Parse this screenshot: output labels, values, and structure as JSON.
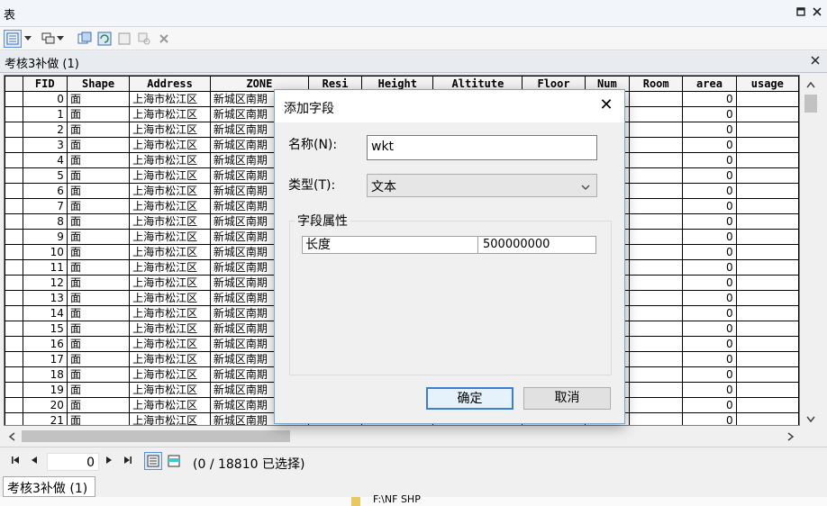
{
  "window": {
    "title": "表"
  },
  "table_tab": {
    "title": "考核3补做 (1)"
  },
  "columns": [
    "FID",
    "Shape",
    "Address",
    "ZONE",
    "Resi",
    "Height",
    "Altitute",
    "Floor",
    "Num",
    "Room",
    "area",
    "usage"
  ],
  "rows": [
    {
      "fid": "0",
      "shape": "面",
      "address": "上海市松江区",
      "zone": "新城区南期",
      "area": "0"
    },
    {
      "fid": "1",
      "shape": "面",
      "address": "上海市松江区",
      "zone": "新城区南期",
      "area": "0"
    },
    {
      "fid": "2",
      "shape": "面",
      "address": "上海市松江区",
      "zone": "新城区南期",
      "area": "0"
    },
    {
      "fid": "3",
      "shape": "面",
      "address": "上海市松江区",
      "zone": "新城区南期",
      "area": "0"
    },
    {
      "fid": "4",
      "shape": "面",
      "address": "上海市松江区",
      "zone": "新城区南期",
      "area": "0"
    },
    {
      "fid": "5",
      "shape": "面",
      "address": "上海市松江区",
      "zone": "新城区南期",
      "area": "0"
    },
    {
      "fid": "6",
      "shape": "面",
      "address": "上海市松江区",
      "zone": "新城区南期",
      "area": "0"
    },
    {
      "fid": "7",
      "shape": "面",
      "address": "上海市松江区",
      "zone": "新城区南期",
      "area": "0"
    },
    {
      "fid": "8",
      "shape": "面",
      "address": "上海市松江区",
      "zone": "新城区南期",
      "area": "0"
    },
    {
      "fid": "9",
      "shape": "面",
      "address": "上海市松江区",
      "zone": "新城区南期",
      "area": "0"
    },
    {
      "fid": "10",
      "shape": "面",
      "address": "上海市松江区",
      "zone": "新城区南期",
      "area": "0"
    },
    {
      "fid": "11",
      "shape": "面",
      "address": "上海市松江区",
      "zone": "新城区南期",
      "area": "0"
    },
    {
      "fid": "12",
      "shape": "面",
      "address": "上海市松江区",
      "zone": "新城区南期",
      "area": "0"
    },
    {
      "fid": "13",
      "shape": "面",
      "address": "上海市松江区",
      "zone": "新城区南期",
      "area": "0"
    },
    {
      "fid": "14",
      "shape": "面",
      "address": "上海市松江区",
      "zone": "新城区南期",
      "area": "0"
    },
    {
      "fid": "15",
      "shape": "面",
      "address": "上海市松江区",
      "zone": "新城区南期",
      "area": "0"
    },
    {
      "fid": "16",
      "shape": "面",
      "address": "上海市松江区",
      "zone": "新城区南期",
      "area": "0"
    },
    {
      "fid": "17",
      "shape": "面",
      "address": "上海市松江区",
      "zone": "新城区南期",
      "area": "0"
    },
    {
      "fid": "18",
      "shape": "面",
      "address": "上海市松江区",
      "zone": "新城区南期",
      "area": "0"
    },
    {
      "fid": "19",
      "shape": "面",
      "address": "上海市松江区",
      "zone": "新城区南期",
      "area": "0"
    },
    {
      "fid": "20",
      "shape": "面",
      "address": "上海市松江区",
      "zone": "新城区南期",
      "area": "0"
    },
    {
      "fid": "21",
      "shape": "面",
      "address": "上海市松江区",
      "zone": "新城区南期",
      "area": "0"
    }
  ],
  "status": {
    "record_value": "0",
    "selection_text": "(0 / 18810 已选择)"
  },
  "bottom_tab": {
    "label": "考核3补做 (1)"
  },
  "background_text": "F:\\NF SHP",
  "dialog": {
    "title": "添加字段",
    "close_glyph": "✕",
    "name_label": "名称(N):",
    "name_value": "wkt",
    "type_label": "类型(T):",
    "type_value": "文本",
    "group_label": "字段属性",
    "property_key": "长度",
    "property_value": "500000000",
    "ok_label": "确定",
    "cancel_label": "取消"
  },
  "colors": {
    "dialog_border": "#7aa7d6",
    "primary_button_border": "#3c7fd1"
  }
}
